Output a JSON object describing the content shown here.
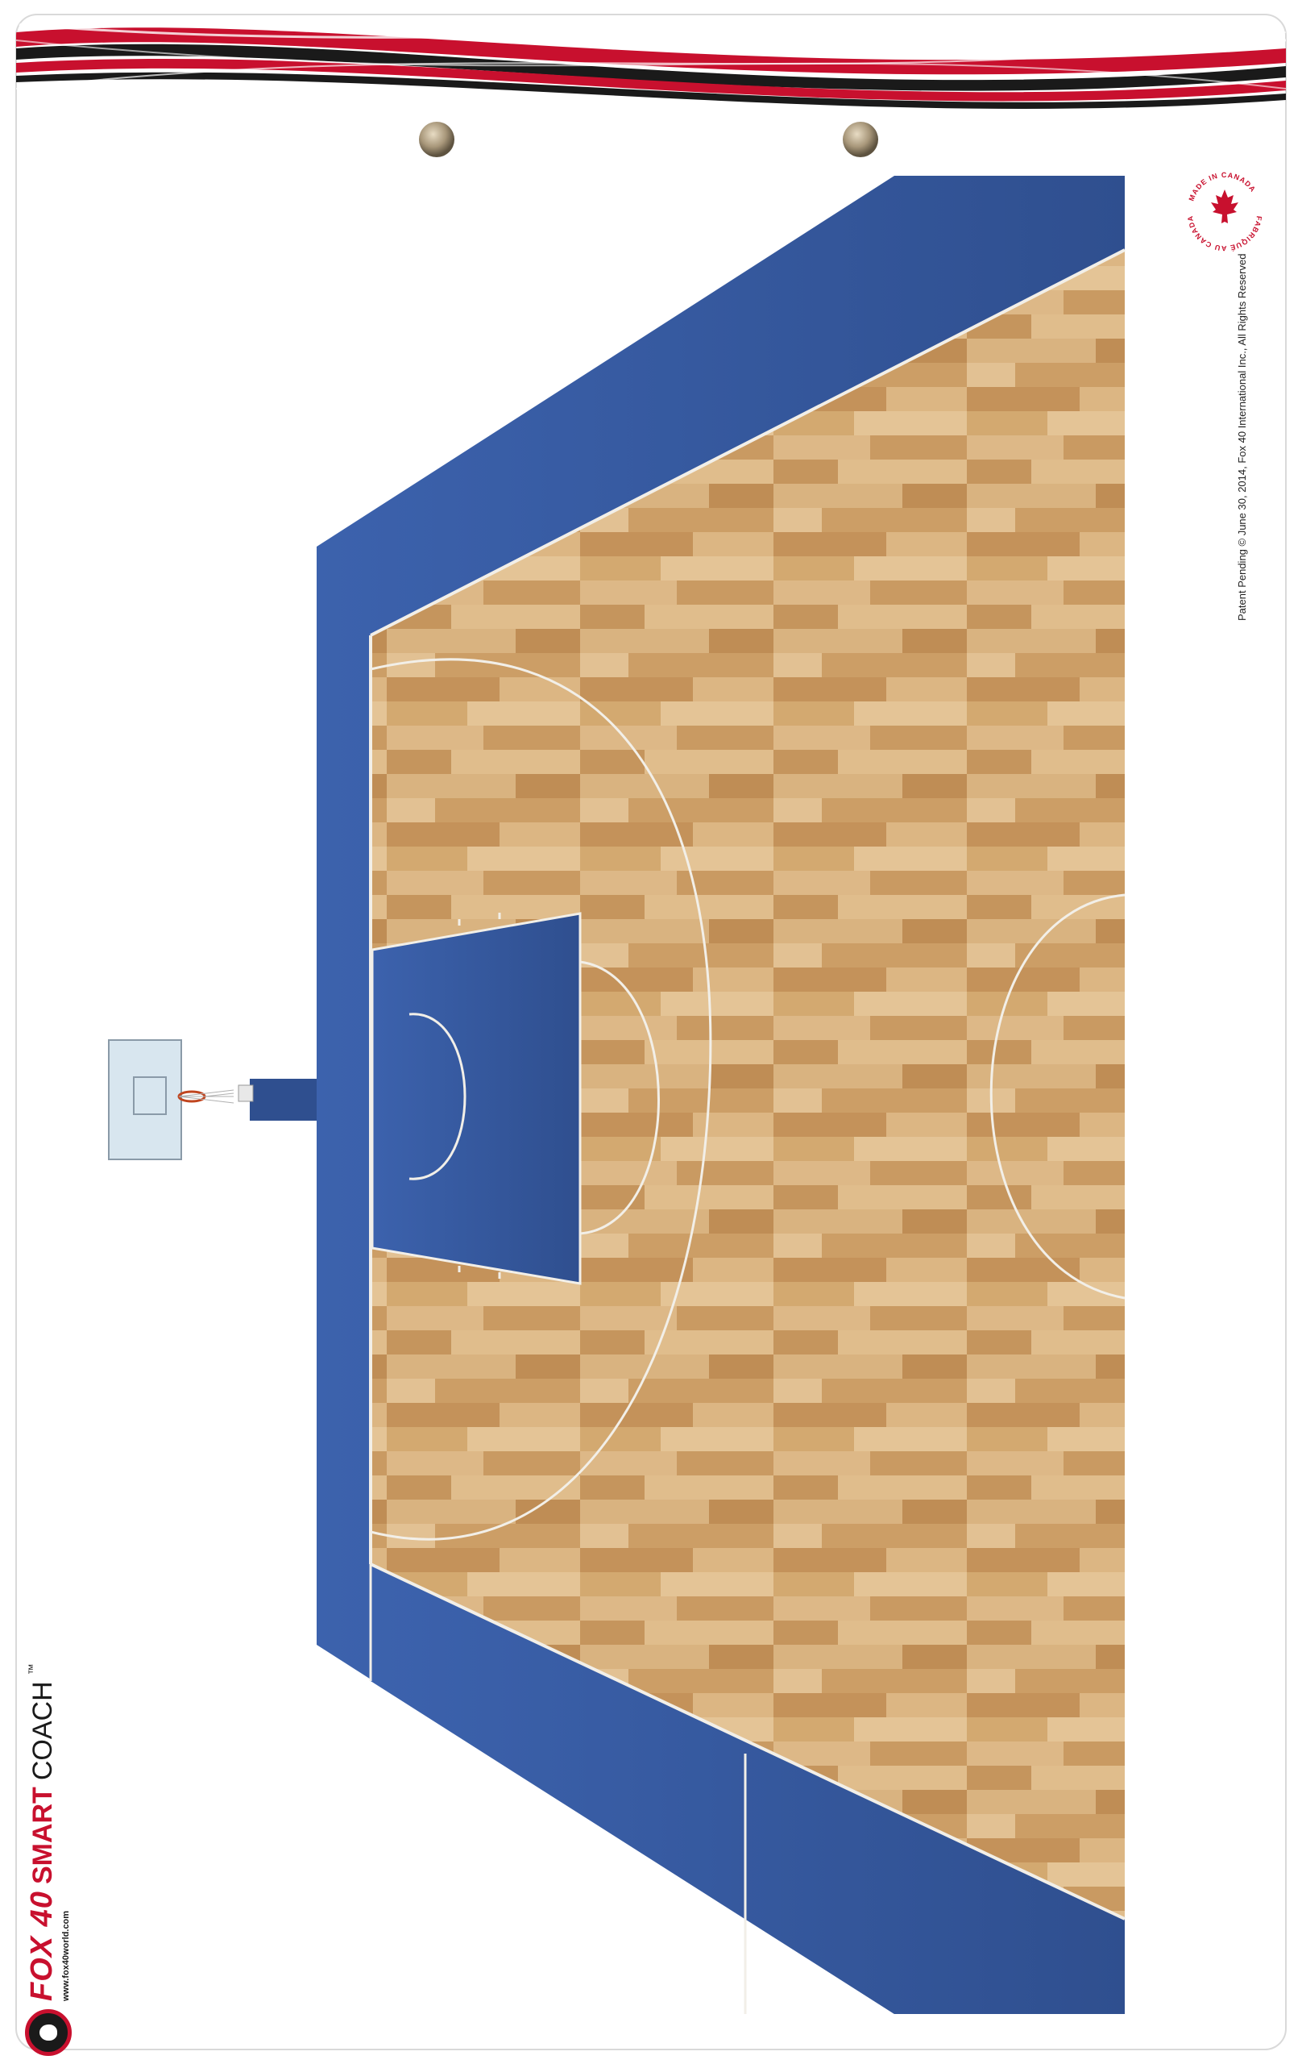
{
  "brand": {
    "name_fox": "FOX 40",
    "name_smart": "SMART",
    "name_coach": "COACH",
    "trademark": "™",
    "url": "www.fox40world.com"
  },
  "seal": {
    "top_text": "MADE IN CANADA",
    "bottom_text": "FABRIQUÉ AU CANADA",
    "icon": "maple-leaf-icon"
  },
  "legal": {
    "patent_text": "Patent Pending © June 30, 2014, Fox 40 International Inc., All Rights Reserved"
  },
  "colors": {
    "court_blue": "#3a5fa8",
    "court_blue_dark": "#2d4c8e",
    "wood_light": "#d9b382",
    "wood_dark": "#b98a55",
    "lines": "#f2efe8",
    "stripe_red": "#c8102e",
    "stripe_black": "#1a1a1a",
    "backboard": "#d8e6ef",
    "rim": "#c0451f"
  }
}
